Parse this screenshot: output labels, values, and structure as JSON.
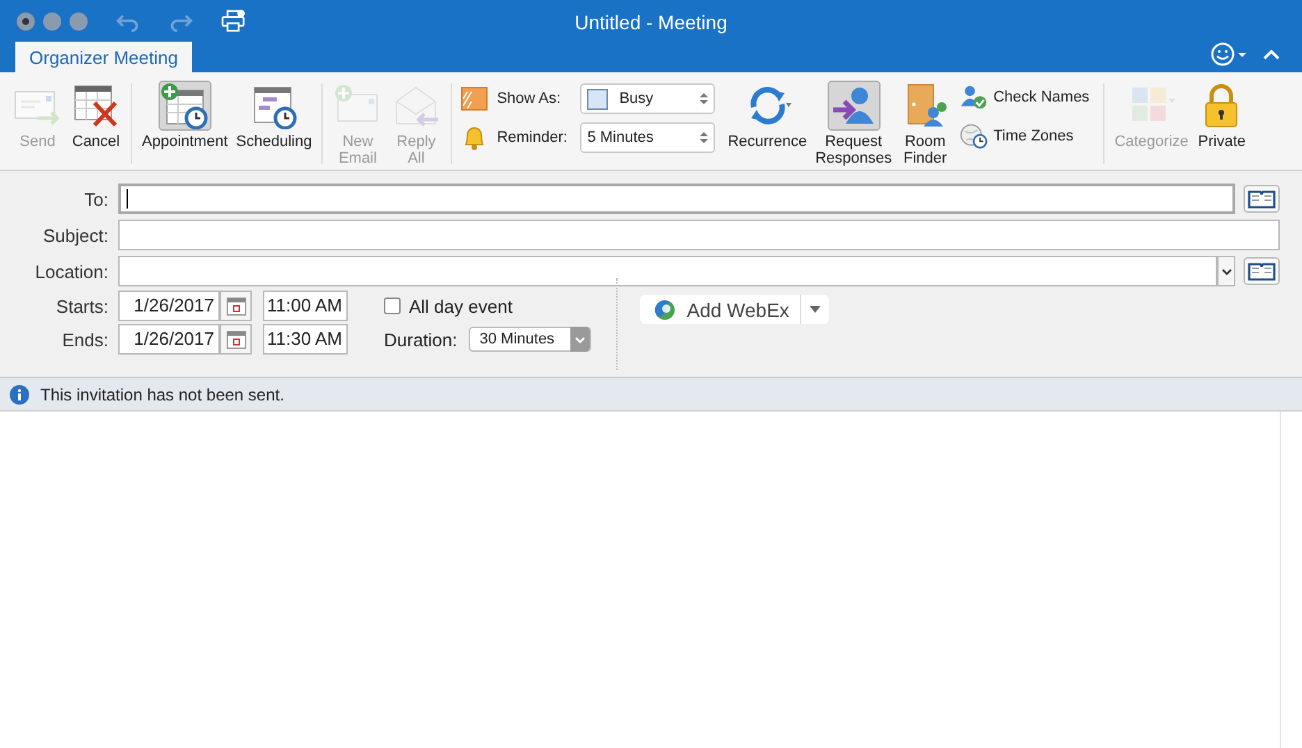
{
  "window": {
    "title": "Untitled - Meeting"
  },
  "tabs": [
    {
      "label": "Organizer Meeting",
      "selected": true
    }
  ],
  "ribbon": {
    "groups": [
      {
        "kind": "large",
        "buttons": [
          {
            "label": "Send",
            "disabled": true,
            "selected": false
          },
          {
            "label": "Cancel",
            "disabled": false,
            "selected": false
          }
        ]
      },
      {
        "kind": "large",
        "buttons": [
          {
            "label": "Appointment",
            "disabled": false,
            "selected": true
          },
          {
            "label": "Scheduling",
            "disabled": false,
            "selected": false
          }
        ]
      },
      {
        "kind": "large",
        "buttons": [
          {
            "label": "New\nEmail",
            "disabled": true,
            "selected": false
          },
          {
            "label": "Reply\nAll",
            "disabled": true,
            "selected": false
          }
        ]
      },
      {
        "kind": "options",
        "show_as": {
          "label": "Show As:",
          "value": "Busy"
        },
        "reminder": {
          "label": "Reminder:",
          "value": "5 Minutes"
        }
      },
      {
        "kind": "large",
        "buttons": [
          {
            "label": "Recurrence",
            "disabled": false,
            "selected": false
          },
          {
            "label": "Request\nResponses",
            "disabled": false,
            "selected": true
          },
          {
            "label": "Room\nFinder",
            "disabled": false,
            "selected": false
          }
        ]
      },
      {
        "kind": "small",
        "buttons": [
          {
            "label": "Check Names"
          },
          {
            "label": "Time Zones"
          }
        ]
      },
      {
        "kind": "large",
        "buttons": [
          {
            "label": "Categorize",
            "disabled": true,
            "selected": false
          },
          {
            "label": "Private",
            "disabled": false,
            "selected": false
          }
        ]
      }
    ]
  },
  "form": {
    "to": {
      "label": "To:"
    },
    "subject": {
      "label": "Subject:"
    },
    "location": {
      "label": "Location:"
    },
    "starts": {
      "label": "Starts:",
      "date": "1/26/2017",
      "time": "11:00 AM"
    },
    "ends": {
      "label": "Ends:",
      "date": "1/26/2017",
      "time": "11:30 AM"
    },
    "all_day": {
      "label": "All day event",
      "checked": false
    },
    "duration": {
      "label": "Duration:",
      "value": "30 Minutes"
    },
    "webex": {
      "label": "Add WebEx"
    }
  },
  "info_bar": {
    "text": "This invitation has not been sent."
  }
}
